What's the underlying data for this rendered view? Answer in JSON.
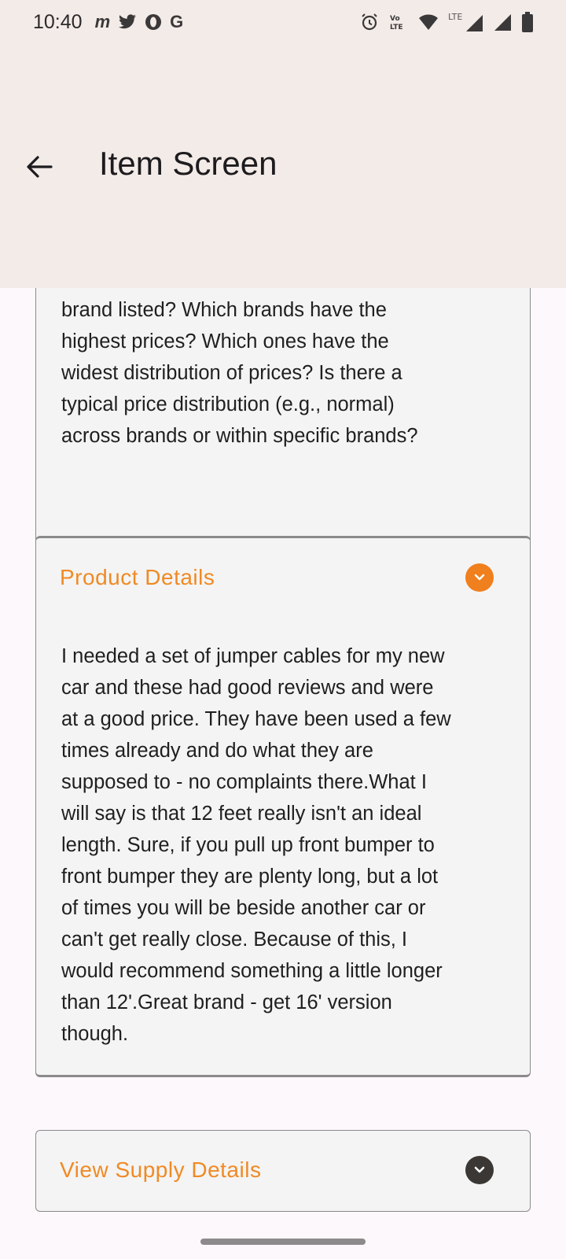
{
  "status_bar": {
    "time": "10:40",
    "app_icons": [
      "m",
      "twitter-icon",
      "opera-icon",
      "G"
    ],
    "network_label": "LTE",
    "volte_label": "Vo LTE"
  },
  "app_bar": {
    "title": "Item Screen",
    "back_icon": "arrow-back-icon"
  },
  "cards": {
    "description": {
      "text": "brand listed? Which brands have the\nhighest prices? Which ones have the\nwidest distribution of prices? Is there a\ntypical price distribution (e.g., normal)\nacross brands or within specific brands?"
    },
    "product_details": {
      "title": "Product Details",
      "expanded": true,
      "text": "I needed a set of jumper cables for my new\ncar and these had good reviews and were\nat a good price. They have been used a few\ntimes already and do what they are\nsupposed to - no complaints there.What I\nwill say is that 12 feet really isn't an ideal\nlength. Sure, if you pull up front bumper to\nfront bumper they are plenty long, but a lot\nof times you will be beside another car or\ncan't get really close. Because of this, I\nwould recommend something a little longer\nthan 12'.Great brand - get 16' version\nthough."
    },
    "supply_details": {
      "title": "View Supply Details",
      "expanded": false
    }
  },
  "colors": {
    "accent": "#ef8a25",
    "app_bar_bg": "#f3ebe8",
    "card_bg": "#f4f4f4"
  }
}
